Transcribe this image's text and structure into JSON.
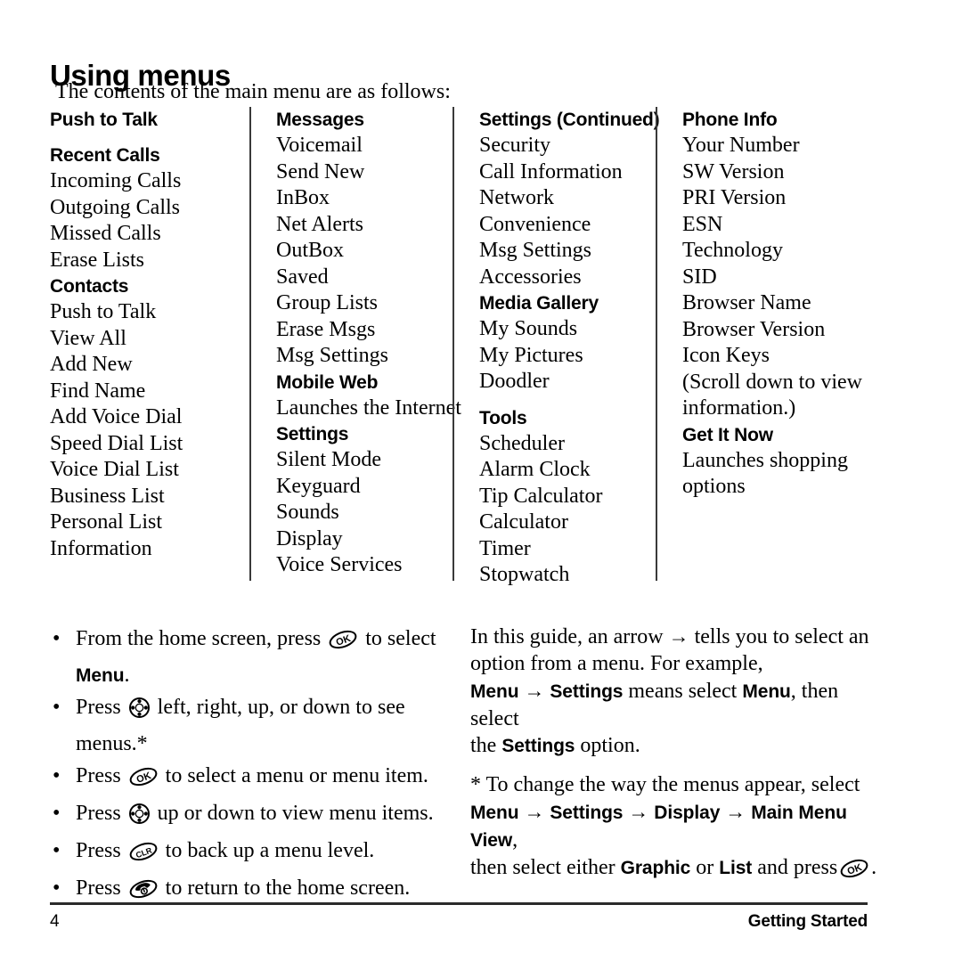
{
  "document": {
    "title": "Using menus",
    "intro": "The contents of the main menu are as follows:"
  },
  "menu_columns": [
    {
      "id": "column-1",
      "entries": [
        {
          "text": "Push to Talk",
          "style": "head"
        },
        {
          "text": "Recent Calls",
          "style": "head-gap"
        },
        {
          "text": "Incoming Calls",
          "style": "item"
        },
        {
          "text": "Outgoing Calls",
          "style": "item"
        },
        {
          "text": "Missed Calls",
          "style": "item"
        },
        {
          "text": "Erase Lists",
          "style": "item"
        },
        {
          "text": "Contacts",
          "style": "head"
        },
        {
          "text": "Push to Talk",
          "style": "item"
        },
        {
          "text": "View All",
          "style": "item"
        },
        {
          "text": "Add New",
          "style": "item"
        },
        {
          "text": "Find Name",
          "style": "item"
        },
        {
          "text": "Add Voice Dial",
          "style": "item"
        },
        {
          "text": "Speed Dial List",
          "style": "item"
        },
        {
          "text": "Voice Dial List",
          "style": "item"
        },
        {
          "text": "Business List",
          "style": "item"
        },
        {
          "text": "Personal List",
          "style": "item"
        },
        {
          "text": "Information",
          "style": "item"
        }
      ]
    },
    {
      "id": "column-2",
      "entries": [
        {
          "text": "Messages",
          "style": "head"
        },
        {
          "text": "Voicemail",
          "style": "item"
        },
        {
          "text": "Send New",
          "style": "item"
        },
        {
          "text": "InBox",
          "style": "item"
        },
        {
          "text": "Net Alerts",
          "style": "item"
        },
        {
          "text": "OutBox",
          "style": "item"
        },
        {
          "text": "Saved",
          "style": "item"
        },
        {
          "text": "Group Lists",
          "style": "item"
        },
        {
          "text": "Erase Msgs",
          "style": "item"
        },
        {
          "text": "Msg Settings",
          "style": "item"
        },
        {
          "text": "Mobile Web",
          "style": "head"
        },
        {
          "text": "Launches the Internet",
          "style": "item"
        },
        {
          "text": "Settings",
          "style": "head"
        },
        {
          "text": "Silent Mode",
          "style": "item"
        },
        {
          "text": "Keyguard",
          "style": "item"
        },
        {
          "text": "Sounds",
          "style": "item"
        },
        {
          "text": "Display",
          "style": "item"
        },
        {
          "text": "Voice Services",
          "style": "item"
        }
      ]
    },
    {
      "id": "column-3",
      "entries": [
        {
          "text": "Settings (Continued)",
          "style": "head"
        },
        {
          "text": "Security",
          "style": "item"
        },
        {
          "text": "Call Information",
          "style": "item"
        },
        {
          "text": "Network",
          "style": "item"
        },
        {
          "text": "Convenience",
          "style": "item"
        },
        {
          "text": "Msg Settings",
          "style": "item"
        },
        {
          "text": "Accessories",
          "style": "item"
        },
        {
          "text": "Media Gallery",
          "style": "head"
        },
        {
          "text": "My Sounds",
          "style": "item"
        },
        {
          "text": "My Pictures",
          "style": "item"
        },
        {
          "text": "Doodler",
          "style": "item"
        },
        {
          "text": "Tools",
          "style": "head-gap"
        },
        {
          "text": "Scheduler",
          "style": "item"
        },
        {
          "text": "Alarm Clock",
          "style": "item"
        },
        {
          "text": "Tip Calculator",
          "style": "item"
        },
        {
          "text": "Calculator",
          "style": "item"
        },
        {
          "text": "Timer",
          "style": "item"
        },
        {
          "text": "Stopwatch",
          "style": "item"
        }
      ]
    },
    {
      "id": "column-4",
      "entries": [
        {
          "text": "Phone Info",
          "style": "head"
        },
        {
          "text": "Your Number",
          "style": "item"
        },
        {
          "text": "SW Version",
          "style": "item"
        },
        {
          "text": "PRI Version",
          "style": "item"
        },
        {
          "text": "ESN",
          "style": "item"
        },
        {
          "text": "Technology",
          "style": "item"
        },
        {
          "text": "SID",
          "style": "item"
        },
        {
          "text": "Browser Name",
          "style": "item"
        },
        {
          "text": "Browser Version",
          "style": "item"
        },
        {
          "text": "Icon Keys",
          "style": "item"
        },
        {
          "text": "(Scroll down to view",
          "style": "item"
        },
        {
          "text": "information.)",
          "style": "item"
        },
        {
          "text": "Get It Now",
          "style": "head"
        },
        {
          "text": "Launches shopping",
          "style": "item"
        },
        {
          "text": "options",
          "style": "item"
        }
      ]
    }
  ],
  "instructions": {
    "bullets": [
      {
        "pre": "From the home screen, press",
        "icon": "ok-key-icon",
        "mid": "to select",
        "bold": "Menu",
        "post": "."
      },
      {
        "pre": "Press",
        "icon": "navigation-key-icon",
        "mid": "left, right, up, or down to see menus.*",
        "bold": "",
        "post": ""
      },
      {
        "pre": "Press",
        "icon": "ok-key-icon",
        "mid": "to select a menu or menu item.",
        "bold": "",
        "post": ""
      },
      {
        "pre": "Press",
        "icon": "navigation-key-icon",
        "mid": "up or down to view menu items.",
        "bold": "",
        "post": ""
      },
      {
        "pre": "Press",
        "icon": "clear-key-icon",
        "mid": "to back up a menu level.",
        "bold": "",
        "post": ""
      },
      {
        "pre": "Press",
        "icon": "end-call-key-icon",
        "mid": "to return to the home screen.",
        "bold": "",
        "post": ""
      }
    ],
    "bullet_glyph": "•"
  },
  "notes": {
    "arrow": "→",
    "guide": {
      "line1": "In this guide, an arrow",
      "line1b": "tells you to select an",
      "line2": "option from a menu. For example,",
      "path_a": "Menu",
      "path_b": "Settings",
      "means": "means select",
      "bold_menu": "Menu",
      "then": ", then select",
      "the": "the",
      "bold_settings": "Settings",
      "option": "option."
    },
    "footnote": {
      "line1": "* To change the way the menus appear, select",
      "p1": "Menu",
      "p2": "Settings",
      "p3": "Display",
      "p4": "Main Menu View",
      "comma": ",",
      "tail_pre": "then select either",
      "tail_b1": "Graphic",
      "tail_or": "or",
      "tail_b2": "List",
      "tail_post": "and press",
      "tail_end": "."
    }
  },
  "footer": {
    "page_number": "4",
    "section": "Getting Started"
  },
  "colors": {
    "text": "#000000",
    "rule": "#2b2b2b",
    "divider": "#3a3a3a"
  }
}
